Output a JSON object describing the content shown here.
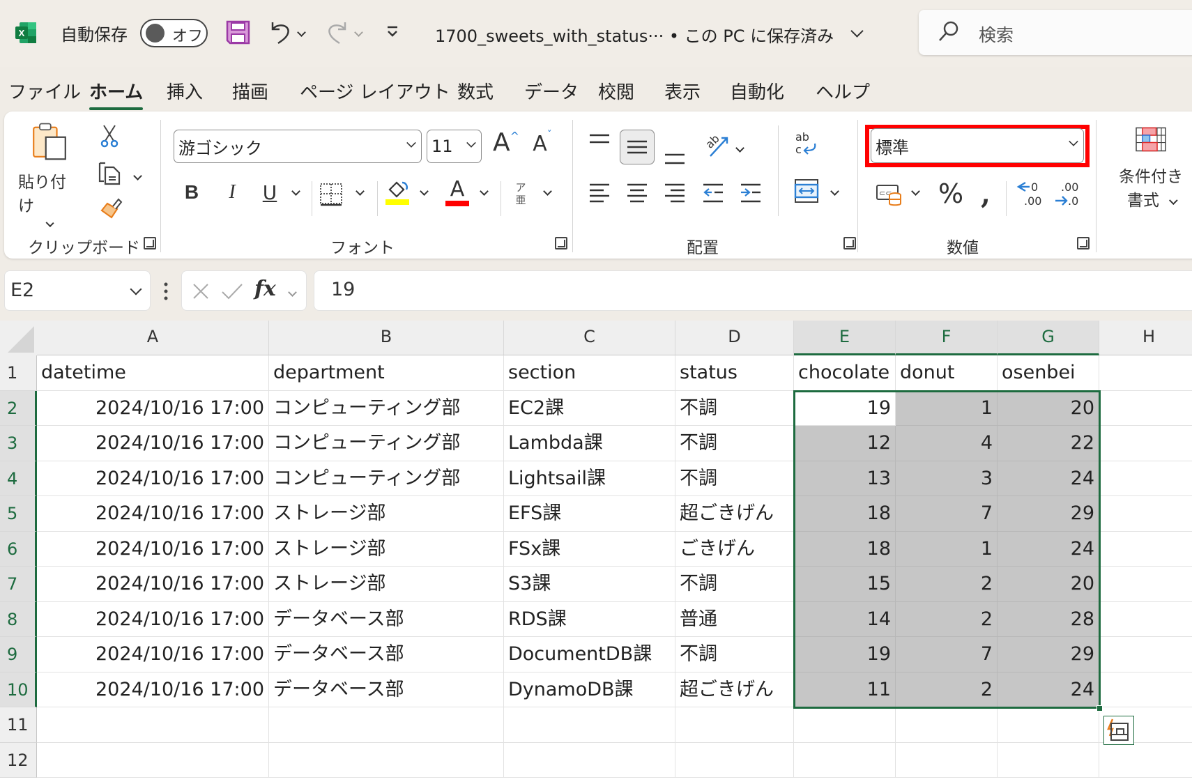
{
  "titlebar": {
    "app_icon": "excel-icon",
    "autosave_label": "自動保存",
    "autosave_state": "オフ",
    "save_icon": "save-icon",
    "undo_icon": "undo-icon",
    "redo_icon": "redo-icon",
    "customize_icon": "customize-qat-icon",
    "filename": "1700_sweets_with_status··· • この PC に保存済み",
    "search_placeholder": "検索"
  },
  "tabs": [
    {
      "label": "ファイル",
      "active": false
    },
    {
      "label": "ホーム",
      "active": true
    },
    {
      "label": "挿入",
      "active": false
    },
    {
      "label": "描画",
      "active": false
    },
    {
      "label": "ページ レイアウト",
      "active": false
    },
    {
      "label": "数式",
      "active": false
    },
    {
      "label": "データ",
      "active": false
    },
    {
      "label": "校閲",
      "active": false
    },
    {
      "label": "表示",
      "active": false
    },
    {
      "label": "自動化",
      "active": false
    },
    {
      "label": "ヘルプ",
      "active": false
    }
  ],
  "ribbon": {
    "clipboard": {
      "label": "クリップボード",
      "paste_label": "貼り付け"
    },
    "font": {
      "label": "フォント",
      "font_name": "游ゴシック",
      "font_size": "11",
      "bold": "B",
      "italic": "I",
      "underline": "U",
      "phonetic_top": "ア",
      "phonetic_bottom": "亜",
      "fill_color": "#ffff00",
      "font_color": "#ff0000"
    },
    "alignment": {
      "label": "配置"
    },
    "number": {
      "label": "数値",
      "format": "標準",
      "percent": "%",
      "comma": "❟",
      "highlight_color": "#ff0000"
    },
    "styles": {
      "conditional_format_line1": "条件付き",
      "conditional_format_line2": "書式"
    }
  },
  "formula_bar": {
    "name_box": "E2",
    "formula": "19"
  },
  "sheet": {
    "columns": [
      "A",
      "B",
      "C",
      "D",
      "E",
      "F",
      "G",
      "H"
    ],
    "selected_columns": [
      "E",
      "F",
      "G"
    ],
    "row_numbers": [
      "1",
      "2",
      "3",
      "4",
      "5",
      "6",
      "7",
      "8",
      "9",
      "10",
      "11",
      "12"
    ],
    "selected_rows": [
      "2",
      "3",
      "4",
      "5",
      "6",
      "7",
      "8",
      "9",
      "10"
    ],
    "header": [
      "datetime",
      "department",
      "section",
      "status",
      "chocolate",
      "donut",
      "osenbei"
    ],
    "rows": [
      [
        "2024/10/16 17:00",
        "コンピューティング部",
        "EC2課",
        "不調",
        "19",
        "1",
        "20"
      ],
      [
        "2024/10/16 17:00",
        "コンピューティング部",
        "Lambda課",
        "不調",
        "12",
        "4",
        "22"
      ],
      [
        "2024/10/16 17:00",
        "コンピューティング部",
        "Lightsail課",
        "不調",
        "13",
        "3",
        "24"
      ],
      [
        "2024/10/16 17:00",
        "ストレージ部",
        "EFS課",
        "超ごきげん",
        "18",
        "7",
        "29"
      ],
      [
        "2024/10/16 17:00",
        "ストレージ部",
        "FSx課",
        "ごきげん",
        "18",
        "1",
        "24"
      ],
      [
        "2024/10/16 17:00",
        "ストレージ部",
        "S3課",
        "不調",
        "15",
        "2",
        "20"
      ],
      [
        "2024/10/16 17:00",
        "データベース部",
        "RDS課",
        "普通",
        "14",
        "2",
        "28"
      ],
      [
        "2024/10/16 17:00",
        "データベース部",
        "DocumentDB課",
        "不調",
        "19",
        "7",
        "29"
      ],
      [
        "2024/10/16 17:00",
        "データベース部",
        "DynamoDB課",
        "超ごきげん",
        "11",
        "2",
        "24"
      ]
    ],
    "active_cell": "E2",
    "selection_range": "E2:G10"
  }
}
